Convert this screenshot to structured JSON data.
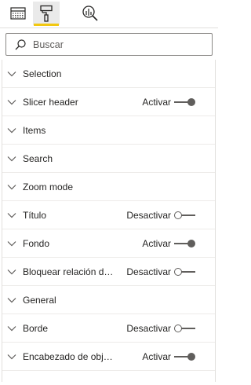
{
  "toolbar": {
    "tabs": [
      {
        "name": "fields",
        "icon": "table-grid-icon"
      },
      {
        "name": "format",
        "icon": "paint-roller-icon",
        "active": true
      },
      {
        "name": "analytics",
        "icon": "magnifier-chart-icon"
      }
    ],
    "active_underline_color": "#f2c811"
  },
  "search": {
    "placeholder": "Buscar",
    "value": ""
  },
  "sections": [
    {
      "label": "Selection"
    },
    {
      "label": "Slicer header",
      "toggle": "Activar",
      "state": "on"
    },
    {
      "label": "Items"
    },
    {
      "label": "Search"
    },
    {
      "label": "Zoom mode"
    },
    {
      "label": "Título",
      "toggle": "Desactivar",
      "state": "off"
    },
    {
      "label": "Fondo",
      "toggle": "Activar",
      "state": "on"
    },
    {
      "label": "Bloquear relación de aspecto",
      "toggle": "Desactivar",
      "state": "off"
    },
    {
      "label": "General"
    },
    {
      "label": "Borde",
      "toggle": "Desactivar",
      "state": "off"
    },
    {
      "label": "Encabezado de objeto visual",
      "toggle": "Activar",
      "state": "on"
    }
  ]
}
